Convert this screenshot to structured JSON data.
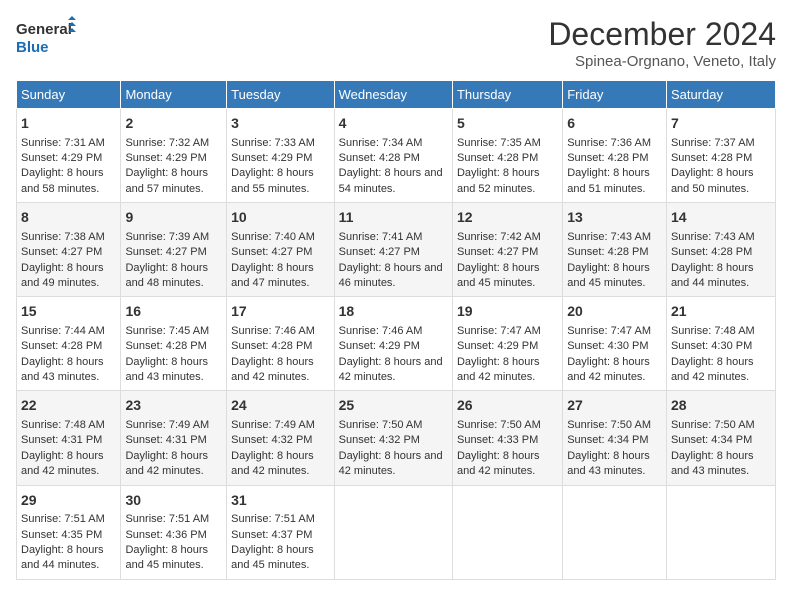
{
  "logo": {
    "line1": "General",
    "line2": "Blue"
  },
  "title": "December 2024",
  "subtitle": "Spinea-Orgnano, Veneto, Italy",
  "days_of_week": [
    "Sunday",
    "Monday",
    "Tuesday",
    "Wednesday",
    "Thursday",
    "Friday",
    "Saturday"
  ],
  "weeks": [
    [
      {
        "day": "1",
        "sunrise": "Sunrise: 7:31 AM",
        "sunset": "Sunset: 4:29 PM",
        "daylight": "Daylight: 8 hours and 58 minutes."
      },
      {
        "day": "2",
        "sunrise": "Sunrise: 7:32 AM",
        "sunset": "Sunset: 4:29 PM",
        "daylight": "Daylight: 8 hours and 57 minutes."
      },
      {
        "day": "3",
        "sunrise": "Sunrise: 7:33 AM",
        "sunset": "Sunset: 4:29 PM",
        "daylight": "Daylight: 8 hours and 55 minutes."
      },
      {
        "day": "4",
        "sunrise": "Sunrise: 7:34 AM",
        "sunset": "Sunset: 4:28 PM",
        "daylight": "Daylight: 8 hours and 54 minutes."
      },
      {
        "day": "5",
        "sunrise": "Sunrise: 7:35 AM",
        "sunset": "Sunset: 4:28 PM",
        "daylight": "Daylight: 8 hours and 52 minutes."
      },
      {
        "day": "6",
        "sunrise": "Sunrise: 7:36 AM",
        "sunset": "Sunset: 4:28 PM",
        "daylight": "Daylight: 8 hours and 51 minutes."
      },
      {
        "day": "7",
        "sunrise": "Sunrise: 7:37 AM",
        "sunset": "Sunset: 4:28 PM",
        "daylight": "Daylight: 8 hours and 50 minutes."
      }
    ],
    [
      {
        "day": "8",
        "sunrise": "Sunrise: 7:38 AM",
        "sunset": "Sunset: 4:27 PM",
        "daylight": "Daylight: 8 hours and 49 minutes."
      },
      {
        "day": "9",
        "sunrise": "Sunrise: 7:39 AM",
        "sunset": "Sunset: 4:27 PM",
        "daylight": "Daylight: 8 hours and 48 minutes."
      },
      {
        "day": "10",
        "sunrise": "Sunrise: 7:40 AM",
        "sunset": "Sunset: 4:27 PM",
        "daylight": "Daylight: 8 hours and 47 minutes."
      },
      {
        "day": "11",
        "sunrise": "Sunrise: 7:41 AM",
        "sunset": "Sunset: 4:27 PM",
        "daylight": "Daylight: 8 hours and 46 minutes."
      },
      {
        "day": "12",
        "sunrise": "Sunrise: 7:42 AM",
        "sunset": "Sunset: 4:27 PM",
        "daylight": "Daylight: 8 hours and 45 minutes."
      },
      {
        "day": "13",
        "sunrise": "Sunrise: 7:43 AM",
        "sunset": "Sunset: 4:28 PM",
        "daylight": "Daylight: 8 hours and 45 minutes."
      },
      {
        "day": "14",
        "sunrise": "Sunrise: 7:43 AM",
        "sunset": "Sunset: 4:28 PM",
        "daylight": "Daylight: 8 hours and 44 minutes."
      }
    ],
    [
      {
        "day": "15",
        "sunrise": "Sunrise: 7:44 AM",
        "sunset": "Sunset: 4:28 PM",
        "daylight": "Daylight: 8 hours and 43 minutes."
      },
      {
        "day": "16",
        "sunrise": "Sunrise: 7:45 AM",
        "sunset": "Sunset: 4:28 PM",
        "daylight": "Daylight: 8 hours and 43 minutes."
      },
      {
        "day": "17",
        "sunrise": "Sunrise: 7:46 AM",
        "sunset": "Sunset: 4:28 PM",
        "daylight": "Daylight: 8 hours and 42 minutes."
      },
      {
        "day": "18",
        "sunrise": "Sunrise: 7:46 AM",
        "sunset": "Sunset: 4:29 PM",
        "daylight": "Daylight: 8 hours and 42 minutes."
      },
      {
        "day": "19",
        "sunrise": "Sunrise: 7:47 AM",
        "sunset": "Sunset: 4:29 PM",
        "daylight": "Daylight: 8 hours and 42 minutes."
      },
      {
        "day": "20",
        "sunrise": "Sunrise: 7:47 AM",
        "sunset": "Sunset: 4:30 PM",
        "daylight": "Daylight: 8 hours and 42 minutes."
      },
      {
        "day": "21",
        "sunrise": "Sunrise: 7:48 AM",
        "sunset": "Sunset: 4:30 PM",
        "daylight": "Daylight: 8 hours and 42 minutes."
      }
    ],
    [
      {
        "day": "22",
        "sunrise": "Sunrise: 7:48 AM",
        "sunset": "Sunset: 4:31 PM",
        "daylight": "Daylight: 8 hours and 42 minutes."
      },
      {
        "day": "23",
        "sunrise": "Sunrise: 7:49 AM",
        "sunset": "Sunset: 4:31 PM",
        "daylight": "Daylight: 8 hours and 42 minutes."
      },
      {
        "day": "24",
        "sunrise": "Sunrise: 7:49 AM",
        "sunset": "Sunset: 4:32 PM",
        "daylight": "Daylight: 8 hours and 42 minutes."
      },
      {
        "day": "25",
        "sunrise": "Sunrise: 7:50 AM",
        "sunset": "Sunset: 4:32 PM",
        "daylight": "Daylight: 8 hours and 42 minutes."
      },
      {
        "day": "26",
        "sunrise": "Sunrise: 7:50 AM",
        "sunset": "Sunset: 4:33 PM",
        "daylight": "Daylight: 8 hours and 42 minutes."
      },
      {
        "day": "27",
        "sunrise": "Sunrise: 7:50 AM",
        "sunset": "Sunset: 4:34 PM",
        "daylight": "Daylight: 8 hours and 43 minutes."
      },
      {
        "day": "28",
        "sunrise": "Sunrise: 7:50 AM",
        "sunset": "Sunset: 4:34 PM",
        "daylight": "Daylight: 8 hours and 43 minutes."
      }
    ],
    [
      {
        "day": "29",
        "sunrise": "Sunrise: 7:51 AM",
        "sunset": "Sunset: 4:35 PM",
        "daylight": "Daylight: 8 hours and 44 minutes."
      },
      {
        "day": "30",
        "sunrise": "Sunrise: 7:51 AM",
        "sunset": "Sunset: 4:36 PM",
        "daylight": "Daylight: 8 hours and 45 minutes."
      },
      {
        "day": "31",
        "sunrise": "Sunrise: 7:51 AM",
        "sunset": "Sunset: 4:37 PM",
        "daylight": "Daylight: 8 hours and 45 minutes."
      },
      null,
      null,
      null,
      null
    ]
  ]
}
